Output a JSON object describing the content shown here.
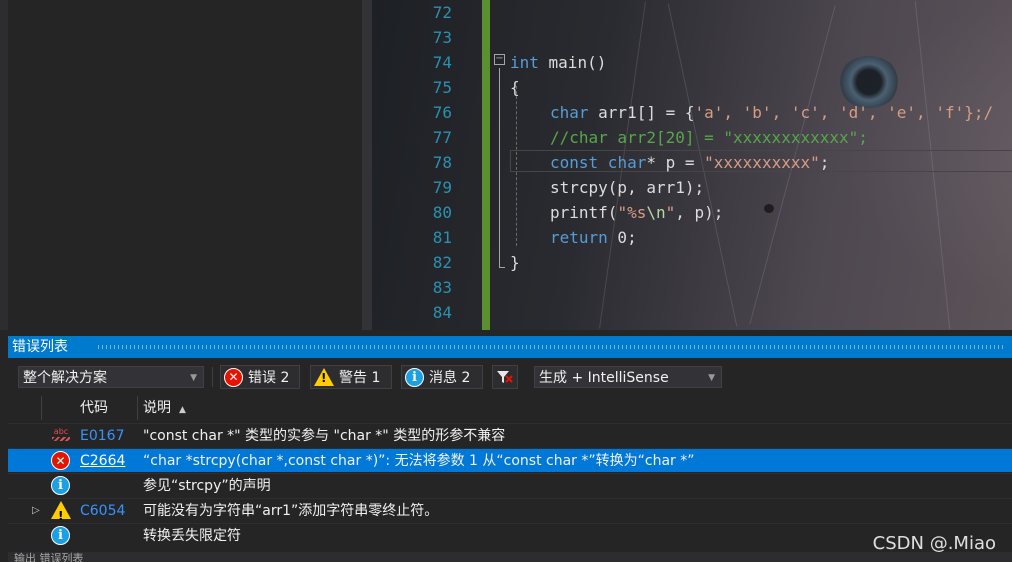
{
  "editor": {
    "line_numbers": [
      "72",
      "73",
      "74",
      "75",
      "76",
      "77",
      "78",
      "79",
      "80",
      "81",
      "82",
      "83",
      "84"
    ],
    "lines": {
      "l74_kw": "int",
      "l74_fn": " main()",
      "l75": "{",
      "l76_kw": "char",
      "l76_rest": " arr1[] = {",
      "l76_vals": "'a', 'b', 'c', 'd', 'e', 'f'};/",
      "l77": "//char arr2[20] = \"xxxxxxxxxxxx\";",
      "l78_kw1": "const",
      "l78_kw2": " char",
      "l78_mid": "* p = ",
      "l78_str": "\"xxxxxxxxxx\"",
      "l78_end": ";",
      "l79": "strcpy(p, arr1);",
      "l80_fn": "printf(",
      "l80_str1": "\"%s",
      "l80_esc": "\\n",
      "l80_str2": "\"",
      "l80_end": ", p);",
      "l81_kw": "return",
      "l81_end": " 0;",
      "l82": "}",
      "collapse_glyph": "−"
    }
  },
  "error_list": {
    "title": "错误列表",
    "scope": "整个解决方案",
    "errors_label": "错误 2",
    "warnings_label": "警告 1",
    "messages_label": "消息 2",
    "build_filter": "生成 + IntelliSense",
    "columns": {
      "code": "代码",
      "description": "说明"
    },
    "rows": [
      {
        "icon": "spell-error-icon",
        "code": "E0167",
        "description": "\"const char *\" 类型的实参与 \"char *\" 类型的形参不兼容"
      },
      {
        "icon": "error-icon",
        "code": "C2664",
        "description": "“char *strcpy(char *,const char *)”: 无法将参数 1 从“const char *”转换为“char *”"
      },
      {
        "icon": "info-icon",
        "code": "",
        "description": "参见“strcpy”的声明"
      },
      {
        "icon": "warning-icon",
        "code": "C6054",
        "description": "可能没有为字符串“arr1”添加字符串零终止符。"
      },
      {
        "icon": "info-icon",
        "code": "",
        "description": "转换丢失限定符"
      }
    ],
    "bottom_tabs": "输出 错误列表"
  },
  "icons": {
    "spell_text": "abc",
    "error_glyph": "✕",
    "info_glyph": "i",
    "warning_glyph": "!",
    "expander": "▷",
    "dropdown": "▼",
    "sort": "▲"
  },
  "watermark": "CSDN @.Miao",
  "colors": {
    "accent": "#007acc",
    "selected_row": "#0078d7",
    "error": "#e51400",
    "warning": "#ffcc00",
    "info": "#1ba1e2",
    "code_link": "#3794ff"
  }
}
